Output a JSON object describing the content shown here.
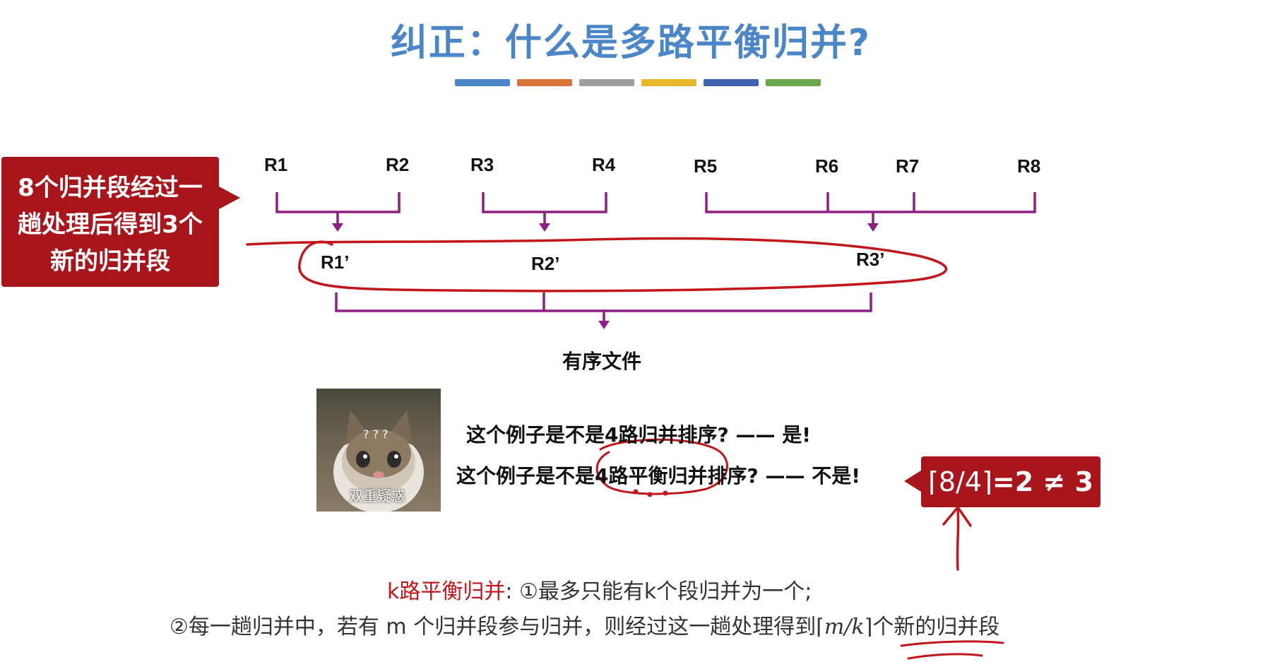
{
  "title": "纠正：什么是多路平衡归并?",
  "title_bar_colors": [
    "#4a86c8",
    "#d9743a",
    "#9e9e9e",
    "#e6b82b",
    "#3f62b0",
    "#6aa84f"
  ],
  "runs": [
    "R1",
    "R2",
    "R3",
    "R4",
    "R5",
    "R6",
    "R7",
    "R8"
  ],
  "merged_runs": [
    "R1’",
    "R2’",
    "R3’"
  ],
  "output_label": "有序文件",
  "callout": {
    "line1": "8个归并段经过一",
    "line2": "趟处理后得到3个",
    "line3": "新的归并段"
  },
  "meme_caption": "双重疑惑",
  "question1": {
    "prefix": "这个例子是不是",
    "highlight": "4路归并",
    "suffix": "排序? —— 是!"
  },
  "question2": {
    "prefix": "这个例子是不是",
    "highlight": "4路平衡归并",
    "suffix": "排序? —— 不是!"
  },
  "formula": {
    "ceil_expr": "8/4",
    "rest": "=2 ≠ 3"
  },
  "definition": {
    "term": "k路平衡归并",
    "line1_rest": ": ①最多只能有k个段归并为一个;",
    "line2_prefix": "②每一趟归并中，若有 m 个归并段参与归并，则经过这一趟处理得到",
    "line2_expr": "m/k",
    "line2_suffix": "个新的归并段"
  },
  "colors": {
    "accent_red": "#a8161b",
    "bracket_purple": "#8e1f84",
    "annotation_red": "#c0161c",
    "title_blue": "#4a86c8"
  }
}
